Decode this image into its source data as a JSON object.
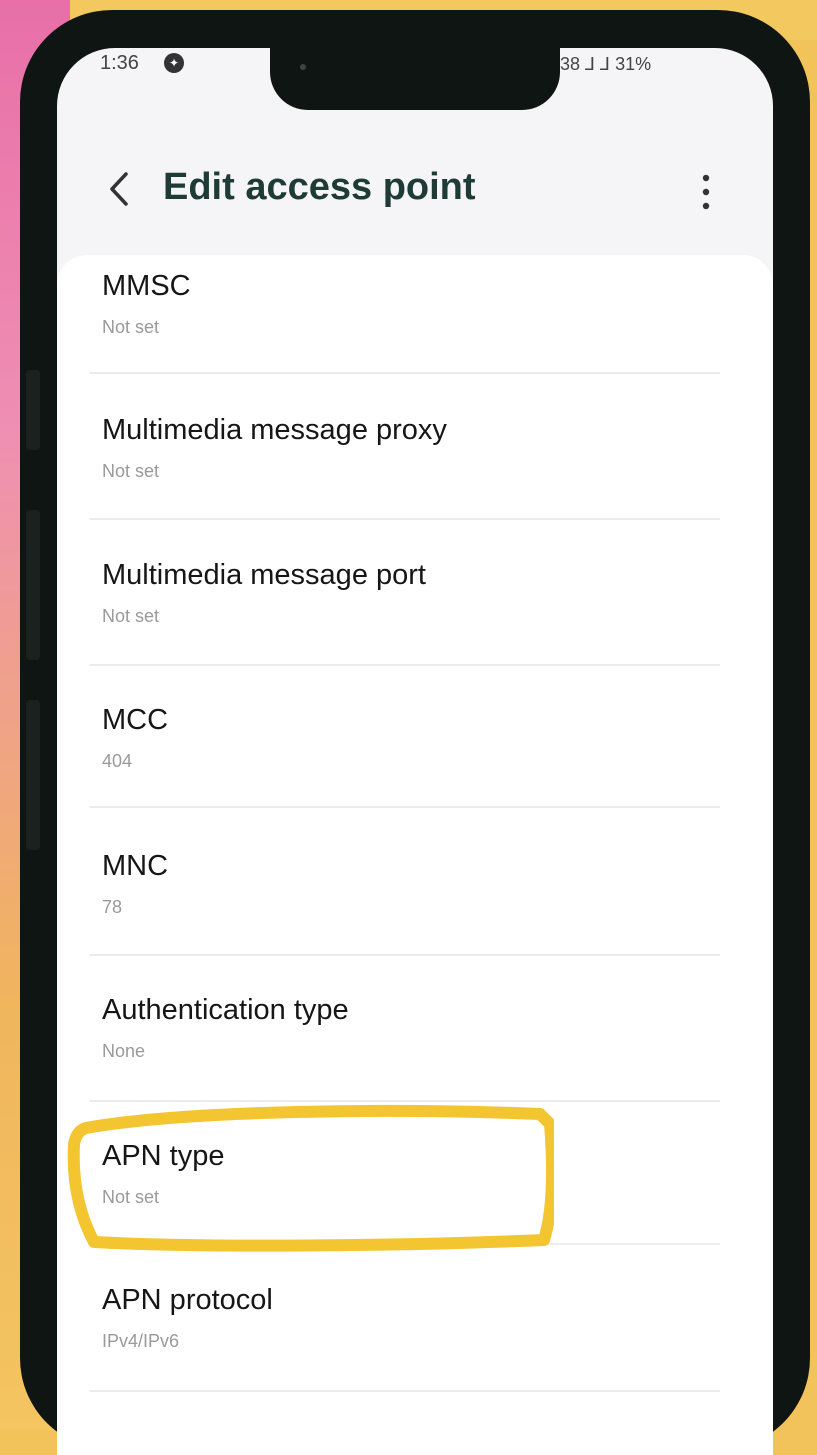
{
  "status_bar": {
    "time": "1:36",
    "right_indicators": "38 ⅃ ⅃ 31%"
  },
  "header": {
    "title": "Edit access point"
  },
  "settings": [
    {
      "label": "MMSC",
      "value": "Not set"
    },
    {
      "label": "Multimedia message proxy",
      "value": "Not set"
    },
    {
      "label": "Multimedia message port",
      "value": "Not set"
    },
    {
      "label": "MCC",
      "value": "404"
    },
    {
      "label": "MNC",
      "value": "78"
    },
    {
      "label": "Authentication type",
      "value": "None"
    },
    {
      "label": "APN type",
      "value": "Not set"
    },
    {
      "label": "APN protocol",
      "value": "IPv4/IPv6"
    }
  ],
  "colors": {
    "title": "#1e3b35",
    "highlight": "#f3c531",
    "background": "#f2c35a"
  },
  "icons": [
    "back-icon",
    "more-options-icon"
  ]
}
